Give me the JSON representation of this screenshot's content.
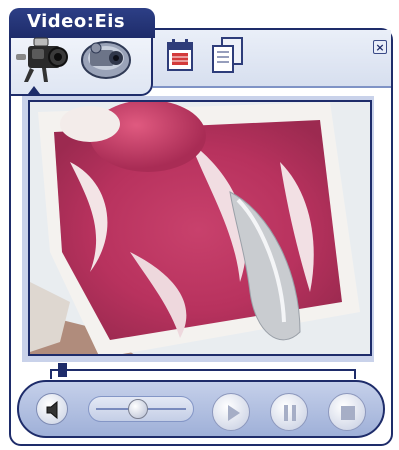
{
  "window": {
    "title": "Video:Eis"
  },
  "tabs": [
    {
      "name": "video-camera",
      "icon": "camcorder-icon",
      "selected": true
    },
    {
      "name": "film-camera",
      "icon": "movie-camera-icon",
      "selected": false
    }
  ],
  "toolbar": [
    {
      "icon": "calendar-icon"
    },
    {
      "icon": "copy-pages-icon"
    }
  ],
  "controls": {
    "volume": 0.45,
    "buttons": [
      "play-icon",
      "pause-icon",
      "stop-icon"
    ]
  },
  "timeline": {
    "position": 0.03
  },
  "colors": {
    "frame": "#1e2c6a",
    "panel": "#c5d0ea"
  }
}
